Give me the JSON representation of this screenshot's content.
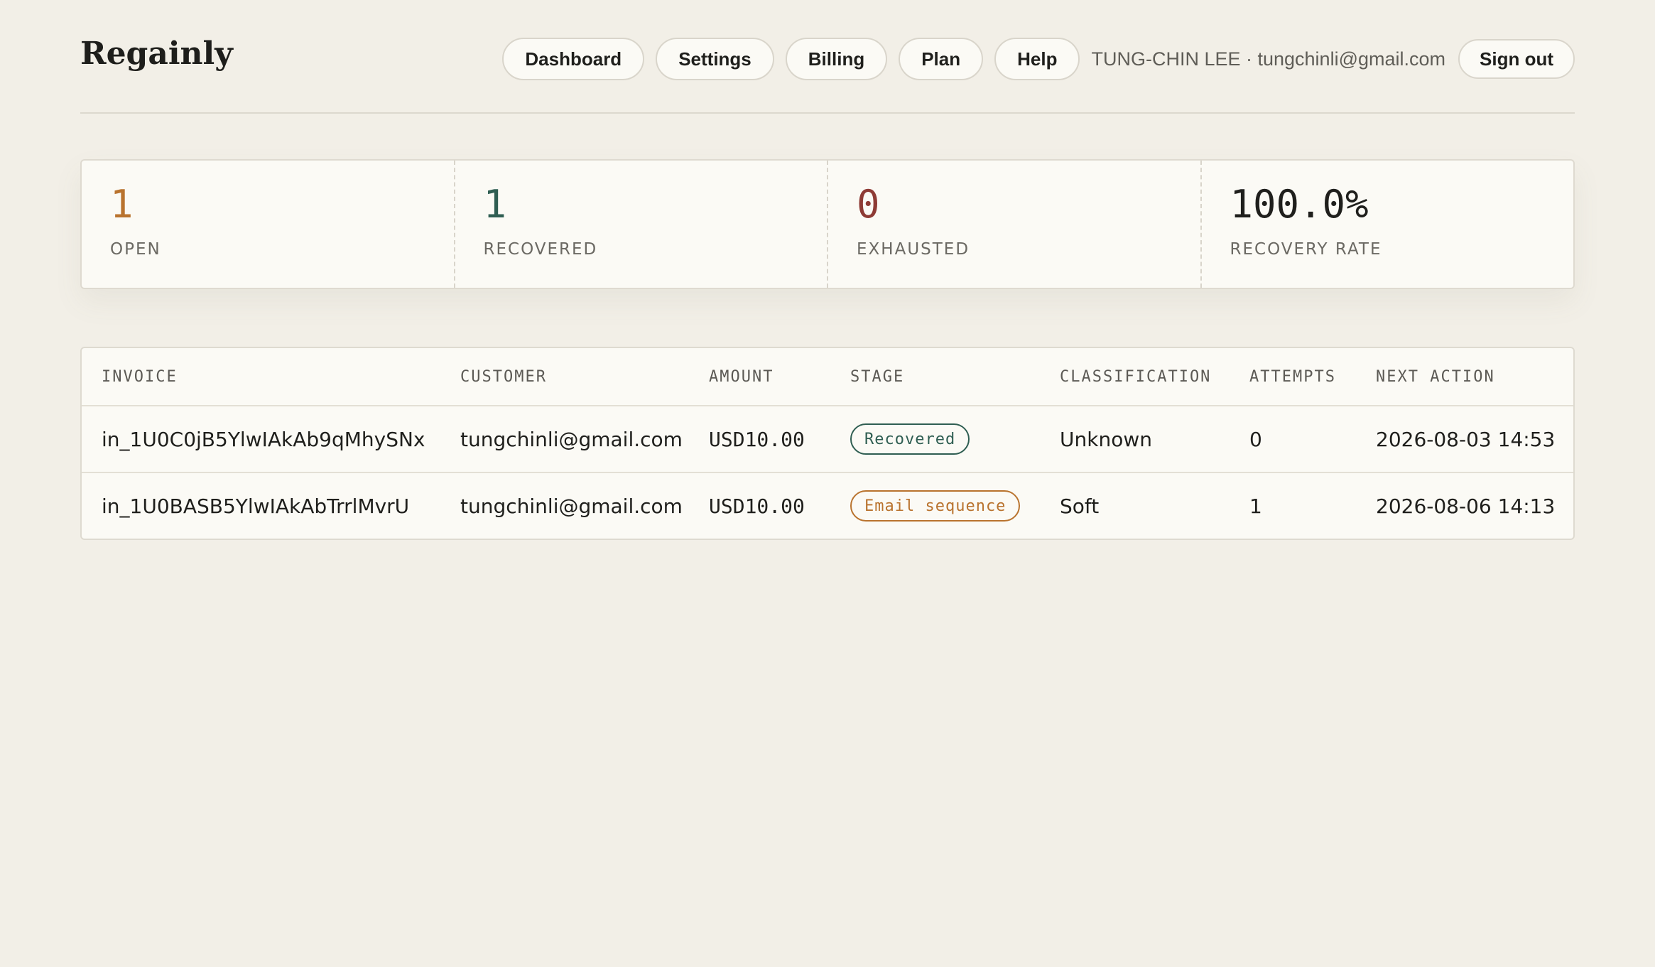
{
  "header": {
    "brand": "Regainly",
    "nav": [
      {
        "label": "Dashboard"
      },
      {
        "label": "Settings"
      },
      {
        "label": "Billing"
      },
      {
        "label": "Plan"
      },
      {
        "label": "Help"
      }
    ],
    "user": "TUNG-CHIN LEE · tungchinli@gmail.com",
    "signout_label": "Sign out"
  },
  "stats": [
    {
      "value": "1",
      "label": "OPEN",
      "color": "#b9732e"
    },
    {
      "value": "1",
      "label": "RECOVERED",
      "color": "#2f5e52"
    },
    {
      "value": "0",
      "label": "EXHAUSTED",
      "color": "#8e3b35"
    },
    {
      "value": "100.0%",
      "label": "RECOVERY RATE",
      "color": "#1f1f1c"
    }
  ],
  "table": {
    "columns": [
      "INVOICE",
      "CUSTOMER",
      "AMOUNT",
      "STAGE",
      "CLASSIFICATION",
      "ATTEMPTS",
      "NEXT ACTION"
    ],
    "rows": [
      {
        "invoice": "in_1U0C0jB5YlwIAkAb9qMhySNx",
        "customer": "tungchinli@gmail.com",
        "amount": "USD10.00",
        "stage": "Recovered",
        "stage_color": "#2f5e52",
        "classification": "Unknown",
        "attempts": "0",
        "next_action": "2026-08-03 14:53"
      },
      {
        "invoice": "in_1U0BASB5YlwIAkAbTrrlMvrU",
        "customer": "tungchinli@gmail.com",
        "amount": "USD10.00",
        "stage": "Email sequence",
        "stage_color": "#b9732e",
        "classification": "Soft",
        "attempts": "1",
        "next_action": "2026-08-06 14:13"
      }
    ]
  }
}
